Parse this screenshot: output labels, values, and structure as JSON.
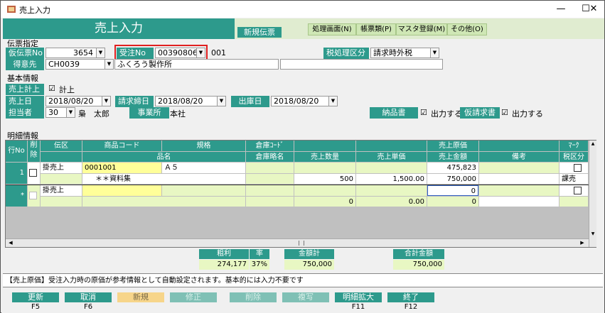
{
  "window": {
    "title": "売上入力",
    "minimize": "—",
    "maximize": "☐",
    "close": "✕"
  },
  "header": {
    "title": "売上入力",
    "mode_badge": "新規伝票",
    "menu": [
      {
        "label": "処理画面(N)"
      },
      {
        "label": "帳票類(P)"
      },
      {
        "label": "マスタ登録(M)"
      },
      {
        "label": "その他(O)"
      }
    ]
  },
  "denpyo": {
    "section": "伝票指定",
    "kari_label": "仮伝票No",
    "kari_value": "3654",
    "juchu_label": "受注No",
    "juchu_value": "00390806",
    "juchu_row": "001",
    "tax_label": "税処理区分",
    "tax_value": "請求時外税",
    "tokui_label": "得意先",
    "tokui_code": "CH0039",
    "tokui_name": "ふくろう製作所",
    "tokui_extra": ""
  },
  "kihon": {
    "section": "基本情報",
    "keijo_label": "売上計上",
    "keijo_check": "☑",
    "keijo_text": "計上",
    "uriage_label": "売上日",
    "uriage_value": "2018/08/20",
    "seikyu_label": "請求締日",
    "seikyu_value": "2018/08/20",
    "shukko_label": "出庫日",
    "shukko_value": "2018/08/20",
    "tanto_label": "担当者",
    "tanto_code": "30",
    "tanto_name": "梟　太郎",
    "jigyo_label": "事業所",
    "jigyo_value": "本社",
    "nohin_label": "納品書",
    "nohin_check": "☑",
    "nohin_text": "出力する",
    "karisei_label": "仮請求書",
    "karisei_check": "☑",
    "karisei_text": "出力する"
  },
  "meisai": {
    "section": "明細情報",
    "headers": {
      "gyo": "行No",
      "sakujo": "削除",
      "denku": "伝区",
      "shohin_code": "商品コード",
      "kikaku": "規格",
      "soko_code": "倉庫ｺｰﾄﾞ",
      "genka": "売上原価",
      "mark": "ﾏｰｸ",
      "hinmei": "品名",
      "soko_name": "倉庫略名",
      "suryo": "売上数量",
      "tanka": "売上単価",
      "kingaku": "売上金額",
      "biko": "備考",
      "zei": "税区分"
    },
    "rows": [
      {
        "no": "1",
        "denku": "掛売上",
        "code": "0001001",
        "kikaku": "Ａ５",
        "genka": "475,823",
        "hinmei": "＊＊資料集",
        "suryo": "500",
        "tanka": "1,500.00",
        "kingaku": "750,000",
        "zei": "課売"
      },
      {
        "no": "*",
        "denku": "掛売上",
        "code": "",
        "kikaku": "",
        "genka": "0",
        "hinmei": "",
        "suryo": "0",
        "tanka": "0.00",
        "kingaku": "0",
        "zei": ""
      }
    ]
  },
  "summary": {
    "arari_label": "粗利",
    "arari_value": "274,177",
    "ritsu_label": "率",
    "ritsu_value": "37%",
    "kingakukei_label": "金額計",
    "kingakukei_value": "750,000",
    "gokei_label": "合計金額",
    "gokei_value": "750,000"
  },
  "status_text": "【売上原価】受注入力時の原価が参考情報として自動設定されます。基本的には入力不要です",
  "fkeys": [
    {
      "label": "更新",
      "key": "F5"
    },
    {
      "label": "取消",
      "key": "F6"
    },
    {
      "label": "新規",
      "key": ""
    },
    {
      "label": "修正",
      "key": ""
    },
    {
      "label": "削除",
      "key": ""
    },
    {
      "label": "複写",
      "key": ""
    },
    {
      "label": "明細拡大",
      "key": "F11"
    },
    {
      "label": "終了",
      "key": "F12"
    }
  ],
  "colors": {
    "accent": "#2d9a8c",
    "highlight_border": "#e02020",
    "input_yellow": "#ffff99",
    "row_green": "#e8f7c3"
  }
}
